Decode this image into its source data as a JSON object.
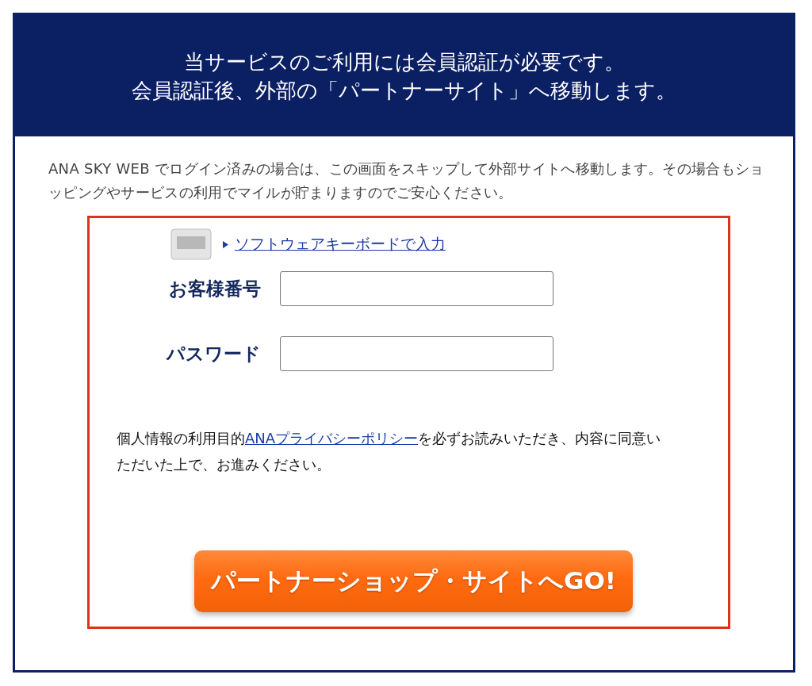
{
  "header": {
    "lines": [
      "当サービスのご利用には会員認証が必要です。",
      "会員認証後、外部の「パートナーサイト」へ移動します。"
    ]
  },
  "notice": "ANA SKY WEB でログイン済みの場合は、この画面をスキップして外部サイトへ移動します。その場合もショッピングやサービスの利用でマイルが貯まりますのでご安心ください。",
  "keyboard_link": "ソフトウェアキーボードで入力",
  "fields": [
    {
      "label": "お客様番号"
    },
    {
      "label": "パスワード"
    }
  ],
  "consent": {
    "before": "個人情報の利用目的",
    "link": "ANAプライバシーポリシー",
    "after": "を必ずお読みいただき、内容に同意いただいた上で、お進みください。"
  },
  "submit_button": "パートナーショップ・サイトへGO!"
}
